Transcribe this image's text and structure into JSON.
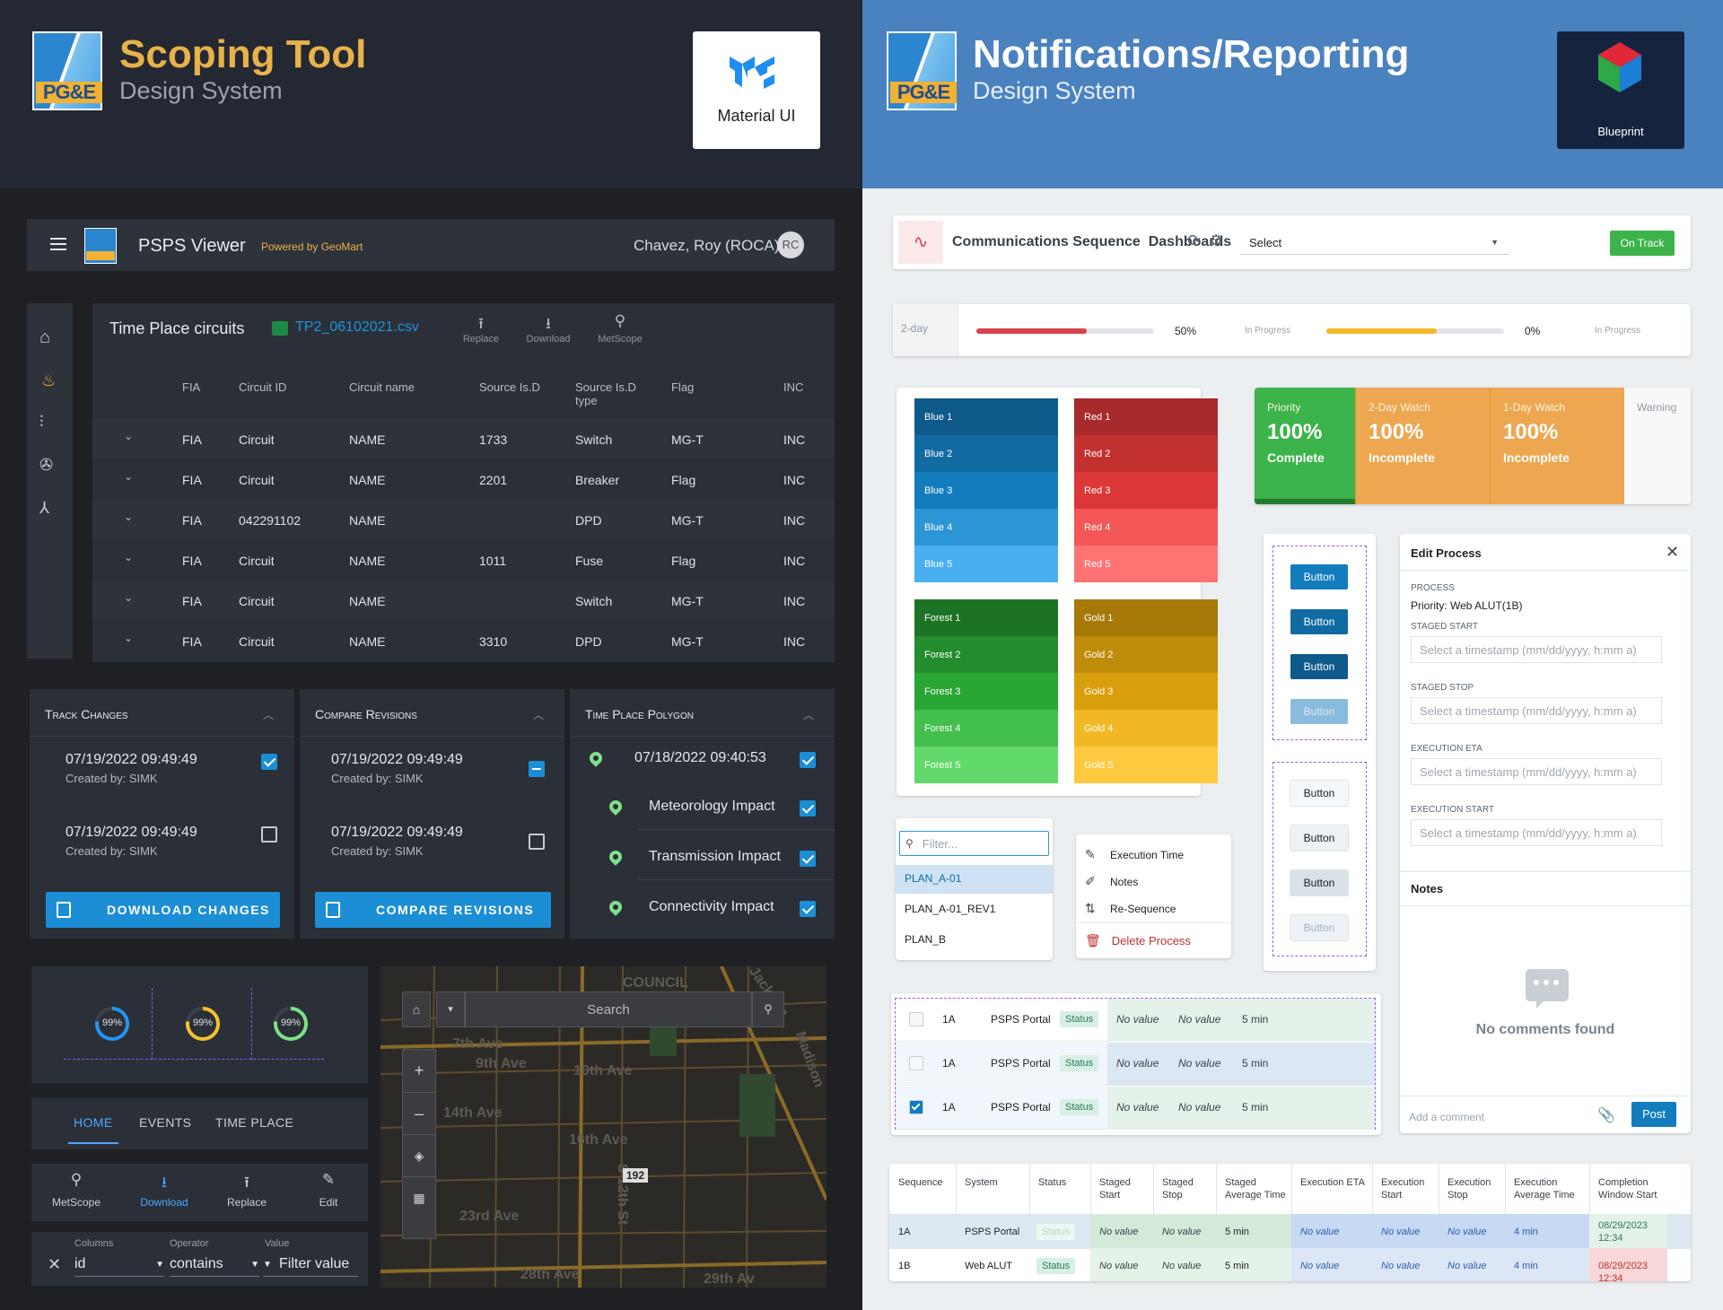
{
  "left": {
    "header": {
      "logo_text": "PG&E",
      "title": "Scoping Tool",
      "subtitle": "Design System",
      "badge_label": "Material UI"
    },
    "appbar": {
      "title": "PSPS Viewer",
      "powered": "Powered by GeoMart",
      "user": "Chavez, Roy (ROCA)",
      "avatar": "RC"
    },
    "table": {
      "title": "Time Place circuits",
      "file": "TP2_06102021.csv",
      "actions": [
        {
          "label": "Replace"
        },
        {
          "label": "Download"
        },
        {
          "label": "MetScope"
        }
      ],
      "columns": [
        "FIA",
        "Circuit ID",
        "Circuit name",
        "Source Is.D",
        "Source Is.D type",
        "Flag",
        "INC"
      ],
      "rows": [
        [
          "FIA",
          "Circuit",
          "NAME",
          "1733",
          "Switch",
          "MG-T",
          "INC"
        ],
        [
          "FIA",
          "Circuit",
          "NAME",
          "2201",
          "Breaker",
          "Flag",
          "INC"
        ],
        [
          "FIA",
          "042291102",
          "NAME",
          "",
          "DPD",
          "MG-T",
          "INC"
        ],
        [
          "FIA",
          "Circuit",
          "NAME",
          "1011",
          "Fuse",
          "Flag",
          "INC"
        ],
        [
          "FIA",
          "Circuit",
          "NAME",
          "",
          "Switch",
          "MG-T",
          "INC"
        ],
        [
          "FIA",
          "Circuit",
          "NAME",
          "3310",
          "DPD",
          "MG-T",
          "INC"
        ]
      ]
    },
    "track": {
      "title": "Track Changes",
      "items": [
        {
          "date": "07/19/2022 09:49:49",
          "by": "Created by: SIMK",
          "checked": true
        },
        {
          "date": "07/19/2022 09:49:49",
          "by": "Created by: SIMK",
          "checked": false
        }
      ],
      "button": "DOWNLOAD CHANGES"
    },
    "compare": {
      "title": "Compare Revisions",
      "items": [
        {
          "date": "07/19/2022 09:49:49",
          "by": "Created by: SIMK",
          "state": "indeterminate"
        },
        {
          "date": "07/19/2022 09:49:49",
          "by": "Created by: SIMK",
          "state": "off"
        }
      ],
      "button": "COMPARE REVISIONS"
    },
    "polygon": {
      "title": "Time Place Polygon",
      "date": "07/18/2022 09:40:53",
      "items": [
        "Meteorology Impact",
        "Transmission Impact",
        "Connectivity Impact"
      ]
    },
    "donuts": [
      {
        "value": "99%",
        "pct": 99,
        "color": "#2196f3"
      },
      {
        "value": "99%",
        "pct": 99,
        "color": "#f2c12e"
      },
      {
        "value": "99%",
        "pct": 99,
        "color": "#7fe08a"
      }
    ],
    "tabs": [
      {
        "label": "HOME",
        "active": true
      },
      {
        "label": "EVENTS"
      },
      {
        "label": "TIME PLACE"
      }
    ],
    "toolbar": [
      {
        "label": "MetScope"
      },
      {
        "label": "Download",
        "active": true
      },
      {
        "label": "Replace"
      },
      {
        "label": "Edit"
      }
    ],
    "filter": {
      "columns_label": "Columns",
      "columns_value": "id",
      "operator_label": "Operator",
      "operator_value": "contains",
      "value_label": "Value",
      "value_value": "Filter value"
    },
    "map": {
      "search": "Search",
      "streets": [
        "7th Ave",
        "9th Ave",
        "10th Ave",
        "14th Ave",
        "16th Ave",
        "23rd Ave",
        "28th Ave",
        "29th Av",
        "S 12th St",
        "Madison",
        "Jackson",
        "COUNCIL"
      ],
      "route": "192"
    }
  },
  "right": {
    "header": {
      "logo_text": "PG&E",
      "title": "Notifications/Reporting",
      "subtitle": "Design System",
      "badge_label": "Blueprint"
    },
    "dashbar": {
      "title": "Communications Sequence  Dashboards",
      "select": "Select",
      "status": "On Track"
    },
    "progress": {
      "label": "2-day",
      "bars": [
        {
          "pct": "50%",
          "fill": 0.62,
          "color": "#d6414b",
          "status": "In Progress"
        },
        {
          "pct": "0%",
          "fill": 0.62,
          "color": "#f2b92b",
          "status": "In Progress"
        }
      ]
    },
    "palette": {
      "blue": [
        {
          "label": "Blue 1",
          "color": "#0e5a8a"
        },
        {
          "label": "Blue 2",
          "color": "#106ba3"
        },
        {
          "label": "Blue 3",
          "color": "#137cbd"
        },
        {
          "label": "Blue 4",
          "color": "#2b95d6"
        },
        {
          "label": "Blue 5",
          "color": "#48aff0"
        }
      ],
      "red": [
        {
          "label": "Red 1",
          "color": "#a82a2a"
        },
        {
          "label": "Red 2",
          "color": "#c23030"
        },
        {
          "label": "Red 3",
          "color": "#db3737"
        },
        {
          "label": "Red 4",
          "color": "#f55656"
        },
        {
          "label": "Red 5",
          "color": "#ff7373"
        }
      ],
      "forest": [
        {
          "label": "Forest 1",
          "color": "#1d7324"
        },
        {
          "label": "Forest 2",
          "color": "#238c2c"
        },
        {
          "label": "Forest 3",
          "color": "#29a634"
        },
        {
          "label": "Forest 4",
          "color": "#43bf4d"
        },
        {
          "label": "Forest 5",
          "color": "#62d96b"
        }
      ],
      "gold": [
        {
          "label": "Gold 1",
          "color": "#a67908"
        },
        {
          "label": "Gold 2",
          "color": "#bf8c0a"
        },
        {
          "label": "Gold 3",
          "color": "#d99e0b"
        },
        {
          "label": "Gold 4",
          "color": "#f2b824"
        },
        {
          "label": "Gold 5",
          "color": "#ffc940"
        }
      ]
    },
    "stats": [
      {
        "label": "Priority",
        "value": "100%",
        "status": "Complete",
        "color": "#3db34b"
      },
      {
        "label": "2-Day Watch",
        "value": "100%",
        "status": "Incomplete",
        "color": "#eda750"
      },
      {
        "label": "1-Day Watch",
        "value": "100%",
        "status": "Incomplete",
        "color": "#eda750"
      },
      {
        "label": "Warning",
        "value": "",
        "status": "",
        "color": "#f7f8f9"
      }
    ],
    "buttons_primary": [
      "Button",
      "Button",
      "Button",
      "Button"
    ],
    "buttons_default": [
      "Button",
      "Button",
      "Button",
      "Button"
    ],
    "filter_menu": {
      "placeholder": "Filter...",
      "items": [
        "PLAN_A-01",
        "PLAN_A-01_REV1",
        "PLAN_B"
      ]
    },
    "action_menu": {
      "items": [
        "Execution Time",
        "Notes",
        "Re-Sequence"
      ],
      "danger": "Delete Process"
    },
    "mini_rows": [
      {
        "seq": "1A",
        "system": "PSPS Portal",
        "status": "Status",
        "v1": "No value",
        "v2": "No value",
        "time": "5 min",
        "checked": false
      },
      {
        "seq": "1A",
        "system": "PSPS Portal",
        "status": "Status",
        "v1": "No value",
        "v2": "No value",
        "time": "5 min",
        "checked": false
      },
      {
        "seq": "1A",
        "system": "PSPS Portal",
        "status": "Status",
        "v1": "No value",
        "v2": "No value",
        "time": "5 min",
        "checked": true
      }
    ],
    "edit": {
      "title": "Edit Process",
      "process_label": "PROCESS",
      "process_value": "Priority: Web ALUT(1B)",
      "fields": [
        "STAGED START",
        "STAGED STOP",
        "EXECUTION ETA",
        "EXECUTION START"
      ],
      "placeholder": "Select a timestamp (mm/dd/yyyy, h:mm a)",
      "notes_title": "Notes",
      "empty": "No comments found",
      "comment_placeholder": "Add a comment",
      "post": "Post"
    },
    "seq_table": {
      "columns": [
        "Sequence",
        "System",
        "Status",
        "Staged Start",
        "Staged Stop",
        "Staged Average Time",
        "Execution ETA",
        "Execution Start",
        "Execution Stop",
        "Execution Average Time",
        "Completion Window Start"
      ],
      "rows": [
        [
          "1A",
          "PSPS Portal",
          "Status",
          "No value",
          "No value",
          "5 min",
          "No value",
          "No value",
          "No value",
          "4 min",
          "08/29/2023 12:34"
        ],
        [
          "1B",
          "Web ALUT",
          "Status",
          "No value",
          "No value",
          "5 min",
          "No value",
          "No value",
          "No value",
          "4 min",
          "08/29/2023 12:34"
        ]
      ]
    }
  }
}
